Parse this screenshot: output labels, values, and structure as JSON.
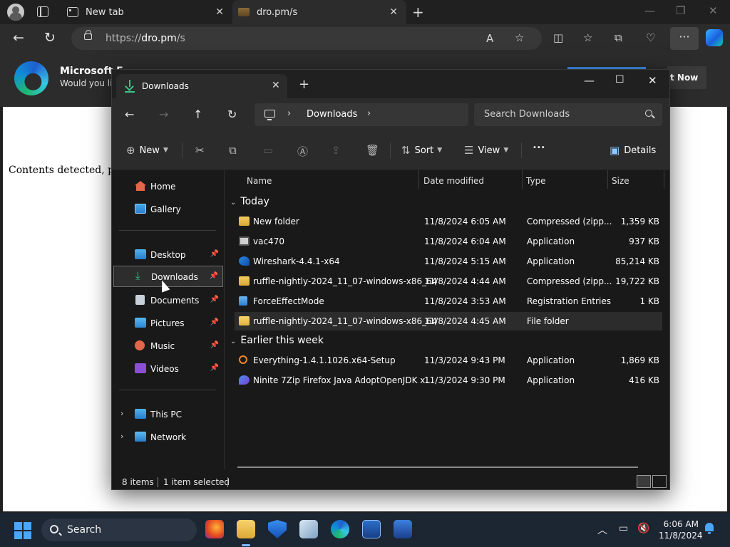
{
  "browser": {
    "tabs": [
      {
        "title": "New tab"
      },
      {
        "title": "dro.pm/s"
      }
    ],
    "url_prefix": "https://",
    "url_host": "dro.pm",
    "url_path": "/s"
  },
  "infobar": {
    "title": "Microsoft E",
    "subtitle": "Would you lik",
    "button": "t Now"
  },
  "page": {
    "message": "Contents detected, pa"
  },
  "explorer": {
    "tab_title": "Downloads",
    "breadcrumb": "Downloads",
    "search_placeholder": "Search Downloads",
    "commands": {
      "new": "New",
      "sort": "Sort",
      "view": "View",
      "more": "•••",
      "details": "Details"
    },
    "sidebar": [
      {
        "label": "Home"
      },
      {
        "label": "Gallery"
      },
      {
        "label": "Desktop"
      },
      {
        "label": "Downloads"
      },
      {
        "label": "Documents"
      },
      {
        "label": "Pictures"
      },
      {
        "label": "Music"
      },
      {
        "label": "Videos"
      },
      {
        "label": "This PC"
      },
      {
        "label": "Network"
      }
    ],
    "columns": [
      "Name",
      "Date modified",
      "Type",
      "Size"
    ],
    "groups": [
      "Today",
      "Earlier this week"
    ],
    "files": [
      {
        "name": "New folder",
        "date": "11/8/2024 6:05 AM",
        "type": "Compressed (zipp...",
        "size": "1,359 KB"
      },
      {
        "name": "vac470",
        "date": "11/8/2024 6:04 AM",
        "type": "Application",
        "size": "937 KB"
      },
      {
        "name": "Wireshark-4.4.1-x64",
        "date": "11/8/2024 5:15 AM",
        "type": "Application",
        "size": "85,214 KB"
      },
      {
        "name": "ruffle-nightly-2024_11_07-windows-x86_64",
        "date": "11/8/2024 4:44 AM",
        "type": "Compressed (zipp...",
        "size": "19,722 KB"
      },
      {
        "name": "ForceEffectMode",
        "date": "11/8/2024 3:53 AM",
        "type": "Registration Entries",
        "size": "1 KB"
      },
      {
        "name": "ruffle-nightly-2024_11_07-windows-x86_64",
        "date": "11/8/2024 4:45 AM",
        "type": "File folder",
        "size": ""
      },
      {
        "name": "Everything-1.4.1.1026.x64-Setup",
        "date": "11/3/2024 9:43 PM",
        "type": "Application",
        "size": "1,869 KB"
      },
      {
        "name": "Ninite 7Zip Firefox Java AdoptOpenJDK x...",
        "date": "11/3/2024 9:30 PM",
        "type": "Application",
        "size": "416 KB"
      }
    ],
    "status": {
      "items": "8 items",
      "selected": "1 item selected"
    }
  },
  "taskbar": {
    "search_label": "Search",
    "time": "6:06 AM",
    "date": "11/8/2024"
  }
}
